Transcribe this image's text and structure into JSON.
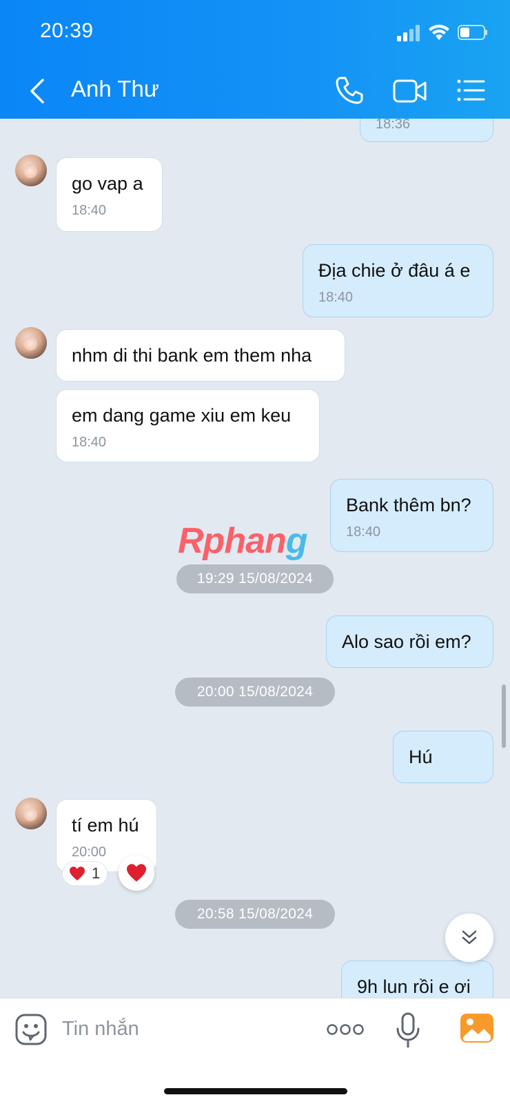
{
  "status": {
    "time": "20:39"
  },
  "header": {
    "title": "Anh Thư"
  },
  "messages": {
    "m0_time": "18:36",
    "m1_text": "go vap a",
    "m1_time": "18:40",
    "m2_text": "Địa chie ở đâu á e",
    "m2_time": "18:40",
    "m3_text": "nhm di thi bank em them nha",
    "m4_text": "em dang game xiu em keu",
    "m4_time": "18:40",
    "m5_text": "Bank thêm bn?",
    "m5_time": "18:40",
    "sep1": "19:29 15/08/2024",
    "m6_text": "Alo sao rồi em?",
    "sep2": "20:00 15/08/2024",
    "m7_text": "Hú",
    "m8_text": "tí em hú",
    "m8_time": "20:00",
    "reaction_count": "1",
    "sep3": "20:58 15/08/2024",
    "m9_text": "9h lun rồi e ơi"
  },
  "watermark": {
    "part1": "Rphan",
    "part2": "g"
  },
  "input": {
    "placeholder": "Tin nhắn"
  },
  "colors": {
    "header": "#0a86f7",
    "outgoing_bubble": "#d5ecfc",
    "incoming_bubble": "#ffffff",
    "background": "#e2e9f1",
    "reaction": "#e0202e"
  },
  "icons": [
    "back-icon",
    "phone-icon",
    "video-call-icon",
    "menu-icon",
    "heart-icon",
    "chevron-double-down-icon",
    "sticker-icon",
    "more-icon",
    "mic-icon",
    "gallery-icon"
  ]
}
